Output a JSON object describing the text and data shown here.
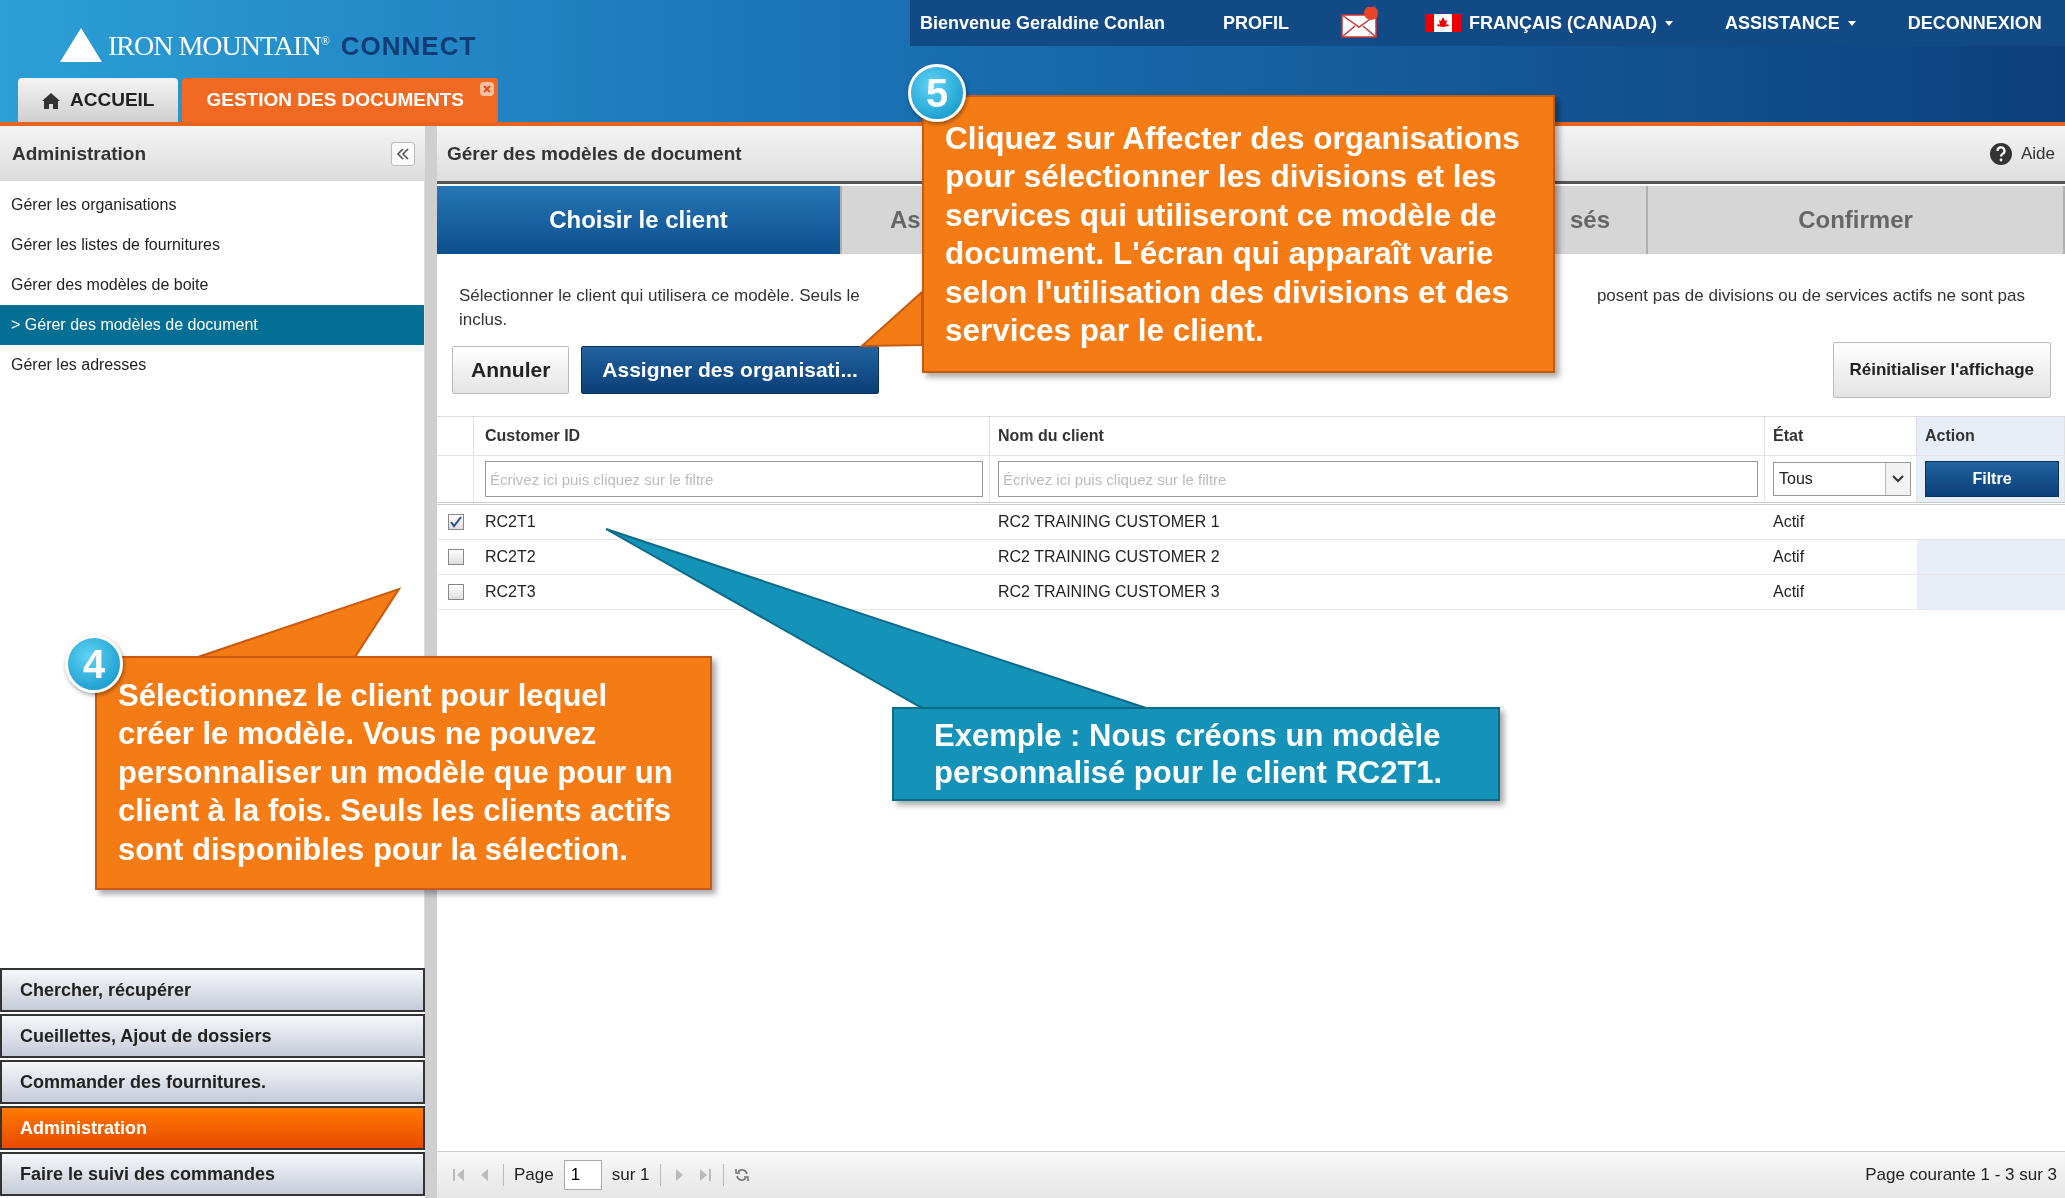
{
  "header": {
    "logo": {
      "name": "IRON MOUNTAIN$^{®}$",
      "product": "CONNECT"
    },
    "top_links": [
      {
        "kind": "text",
        "label": "Bienvenue Geraldine Conlan"
      },
      {
        "kind": "link",
        "label": "PROFIL"
      },
      {
        "kind": "mail"
      },
      {
        "kind": "flag",
        "label": "FRANÇAIS (CANADA)",
        "dropdown": true
      },
      {
        "kind": "link",
        "label": "ASSISTANCE",
        "dropdown": true
      },
      {
        "kind": "link",
        "label": "DECONNEXION"
      }
    ],
    "tabs": [
      {
        "label": "ACCUEIL",
        "kind": "home",
        "selected": false
      },
      {
        "label": "GESTION DES DOCUMENTS",
        "kind": "closable",
        "selected": true
      }
    ]
  },
  "sidebar": {
    "title": "Administration",
    "items": [
      {
        "label": "Gérer les organisations",
        "selected": false
      },
      {
        "label": "Gérer les listes de fournitures",
        "selected": false
      },
      {
        "label": "Gérer des modèles de boite",
        "selected": false
      },
      {
        "label": "> Gérer des modèles de document",
        "selected": true
      },
      {
        "label": "Gérer les adresses",
        "selected": false
      }
    ],
    "sections": [
      {
        "label": "Chercher, récupérer",
        "selected": false
      },
      {
        "label": "Cueillettes, Ajout de dossiers",
        "selected": false
      },
      {
        "label": "Commander des fournitures.",
        "selected": false
      },
      {
        "label": "Administration",
        "selected": true
      },
      {
        "label": "Faire le suivi des commandes",
        "selected": false
      }
    ]
  },
  "main": {
    "title": "Gérer des modèles de document",
    "help": "Aide",
    "steps": [
      {
        "label": "Choisir le client",
        "selected": true
      },
      {
        "label": "As",
        "selected": false
      },
      {
        "label": "sés",
        "selected": false
      },
      {
        "label": "Confirmer",
        "selected": false
      }
    ],
    "description": {
      "left": "Sélectionner le client qui utilisera ce modèle. Seuls le",
      "right": "posent pas de divisions ou de services actifs ne sont pas",
      "line2": "inclus."
    },
    "buttons": [
      {
        "label": "Annuler",
        "kind": "plain"
      },
      {
        "label": "Assigner des organisati...",
        "kind": "primary"
      }
    ],
    "reset_button": "Réinitialiser l'affichage",
    "table": {
      "columns": [
        "Customer ID",
        "Nom du client",
        "État",
        "Action"
      ],
      "filters": {
        "id_placeholder": "Écrivez ici puis cliquez sur le filtre",
        "name_placeholder": "Écrivez ici puis cliquez sur le filtre",
        "state_value": "Tous",
        "button": "Filtre"
      },
      "rows": [
        {
          "checked": true,
          "id": "RC2T1",
          "name": "RC2 TRAINING CUSTOMER 1",
          "state": "Actif"
        },
        {
          "checked": false,
          "id": "RC2T2",
          "name": "RC2 TRAINING CUSTOMER 2",
          "state": "Actif"
        },
        {
          "checked": false,
          "id": "RC2T3",
          "name": "RC2 TRAINING CUSTOMER 3",
          "state": "Actif"
        }
      ]
    },
    "pager": {
      "page_label": "Page",
      "page": "1",
      "of": "sur 1",
      "summary": "Page courante 1 - 3 sur 3"
    }
  },
  "callouts": [
    {
      "kind": "orange",
      "number": "5",
      "text": "Cliquez sur Affecter des organisations pour sélectionner les divisions et les services qui utiliseront ce modèle de document. L'écran qui apparaît varie selon l'utilisation des divisions et des services par le client."
    },
    {
      "kind": "orange",
      "number": "4",
      "text": "Sélectionnez le client pour lequel créer le modèle. Vous ne pouvez personnaliser un modèle que pour un client à la fois. Seuls les clients actifs sont disponibles pour la sélection."
    },
    {
      "kind": "blue",
      "text": "Exemple : Nous créons un modèle personnalisé pour le client RC2T1."
    }
  ]
}
